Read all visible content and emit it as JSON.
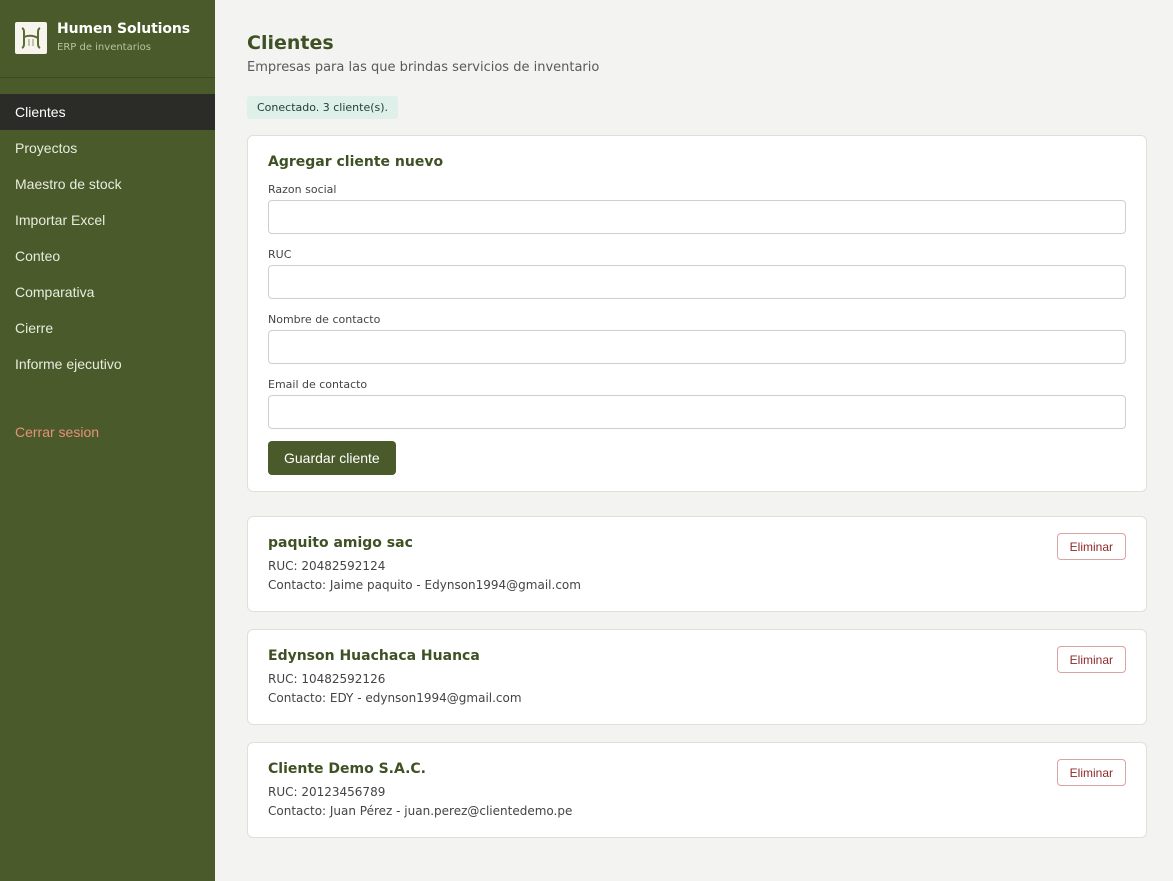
{
  "brand": {
    "name": "Humen Solutions",
    "subtitle": "ERP de inventarios"
  },
  "sidebar": {
    "items": [
      {
        "label": "Clientes",
        "active": true
      },
      {
        "label": "Proyectos"
      },
      {
        "label": "Maestro de stock"
      },
      {
        "label": "Importar Excel"
      },
      {
        "label": "Conteo"
      },
      {
        "label": "Comparativa"
      },
      {
        "label": "Cierre"
      },
      {
        "label": "Informe ejecutivo"
      }
    ],
    "logout_label": "Cerrar sesion"
  },
  "page": {
    "title": "Clientes",
    "subtitle": "Empresas para las que brindas servicios de inventario",
    "status": "Conectado. 3 cliente(s)."
  },
  "form": {
    "title": "Agregar cliente nuevo",
    "fields": [
      {
        "label": "Razon social",
        "value": ""
      },
      {
        "label": "RUC",
        "value": ""
      },
      {
        "label": "Nombre de contacto",
        "value": ""
      },
      {
        "label": "Email de contacto",
        "value": ""
      }
    ],
    "save_label": "Guardar cliente"
  },
  "clients": [
    {
      "name": "paquito amigo sac",
      "ruc": "RUC: 20482592124",
      "contact": "Contacto: Jaime paquito - Edynson1994@gmail.com",
      "delete_label": "Eliminar"
    },
    {
      "name": "Edynson Huachaca Huanca",
      "ruc": "RUC: 10482592126",
      "contact": "Contacto: EDY - edynson1994@gmail.com",
      "delete_label": "Eliminar"
    },
    {
      "name": "Cliente Demo S.A.C.",
      "ruc": "RUC: 20123456789",
      "contact": "Contacto: Juan Pérez - juan.perez@clientedemo.pe",
      "delete_label": "Eliminar"
    }
  ],
  "colors": {
    "sidebar": "#4a5a2a",
    "active": "#2b2b27",
    "accent": "#3f5124",
    "logout": "#e6917a",
    "danger": "#8f2a2a"
  }
}
